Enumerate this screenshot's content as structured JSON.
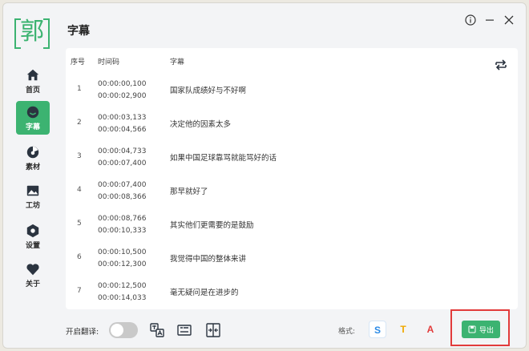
{
  "app": {
    "logo_text": "郭",
    "page_title": "字幕"
  },
  "sidebar": {
    "items": [
      {
        "label": "首页",
        "icon": "home-icon"
      },
      {
        "label": "字幕",
        "icon": "subtitle-icon",
        "active": true
      },
      {
        "label": "素材",
        "icon": "material-icon"
      },
      {
        "label": "工坊",
        "icon": "image-icon"
      },
      {
        "label": "设置",
        "icon": "settings-icon"
      },
      {
        "label": "关于",
        "icon": "heart-icon"
      }
    ]
  },
  "window_controls": [
    "info-icon",
    "minimize-icon",
    "close-icon"
  ],
  "table": {
    "headers": {
      "index": "序号",
      "time": "时间码",
      "text": "字幕"
    },
    "rows": [
      {
        "index": "1",
        "start": "00:00:00,100",
        "end": "00:00:02,900",
        "text": "国家队成绩好与不好啊"
      },
      {
        "index": "2",
        "start": "00:00:03,133",
        "end": "00:00:04,566",
        "text": "决定他的因素太多"
      },
      {
        "index": "3",
        "start": "00:00:04,733",
        "end": "00:00:07,400",
        "text": "如果中国足球靠骂就能骂好的话"
      },
      {
        "index": "4",
        "start": "00:00:07,400",
        "end": "00:00:08,366",
        "text": "那早就好了"
      },
      {
        "index": "5",
        "start": "00:00:08,766",
        "end": "00:00:10,333",
        "text": "其实他们更需要的是鼓励"
      },
      {
        "index": "6",
        "start": "00:00:10,500",
        "end": "00:00:12,300",
        "text": "我觉得中国的整体来讲"
      },
      {
        "index": "7",
        "start": "00:00:12,500",
        "end": "00:00:14,033",
        "text": "毫无疑问是在进步的"
      }
    ]
  },
  "bottom": {
    "translate_label": "开启翻译:",
    "translate_enabled": false,
    "format_label": "格式:",
    "formats": {
      "s": "S",
      "t": "T",
      "a": "A"
    },
    "export_label": "导出"
  },
  "colors": {
    "accent": "#3cb371",
    "highlight": "#e23b3b",
    "format_s": "#2a8ae6",
    "format_t": "#f0a800",
    "format_a": "#e23b3b"
  }
}
